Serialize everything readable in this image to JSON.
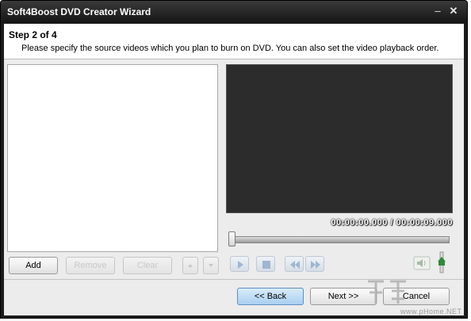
{
  "window": {
    "title": "Soft4Boost DVD Creator Wizard",
    "minimize_glyph": "–",
    "close_glyph": "✕"
  },
  "header": {
    "step": "Step 2 of 4",
    "description": "Please specify the source videos which you plan to burn on DVD. You can also set the video playback order."
  },
  "list": {
    "items": []
  },
  "player": {
    "current_time": "00:00:00.000",
    "separator": "/",
    "total_time": "00:00:09.000",
    "seek_position": 0,
    "controls": [
      "play-icon",
      "stop-icon",
      "rewind-icon",
      "fast-forward-icon"
    ],
    "volume_icon": "speaker-icon"
  },
  "list_buttons": {
    "add": "Add",
    "remove": "Remove",
    "clear": "Clear",
    "up_icon": "arrow-up-icon",
    "down_icon": "arrow-down-icon"
  },
  "nav": {
    "back": "<< Back",
    "next": "Next >>",
    "cancel": "Cancel"
  },
  "watermark": {
    "text": "www.pHome.NET"
  },
  "colors": {
    "title_bar": "#1c1c1c",
    "preview_bg": "#2c2c2c",
    "back_button": "#a9cff0",
    "panel_bg": "#ececec"
  }
}
